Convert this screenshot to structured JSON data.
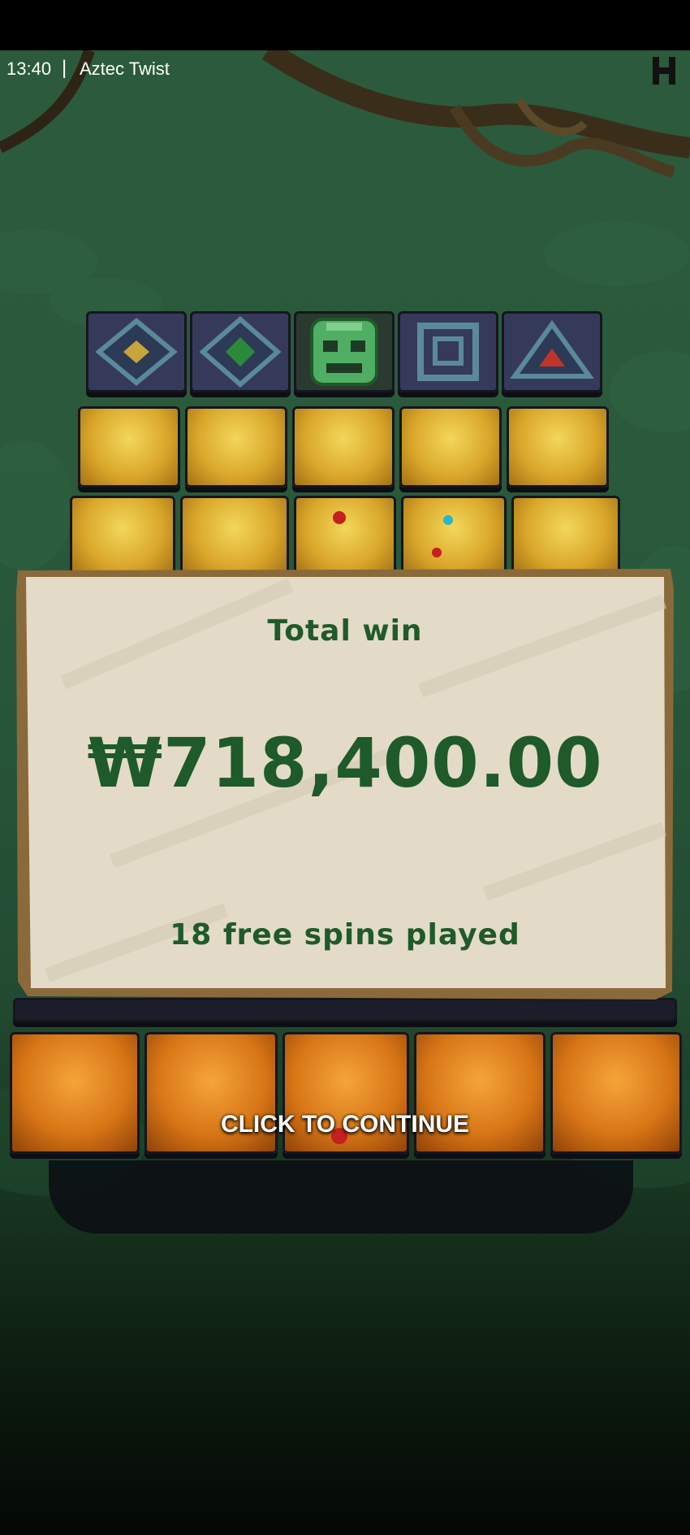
{
  "status_bar": {
    "time": "13:40",
    "separator": "|",
    "app_title": "Aztec Twist"
  },
  "reels": {
    "top_symbols": [
      "gold-diamond-symbol",
      "green-diamond-symbol",
      "mask-symbol",
      "square-spiral-symbol",
      "red-triangle-symbol"
    ]
  },
  "win_panel": {
    "label": "Total win",
    "amount": "₩718,400.00",
    "free_spins_text": "18 free spins played"
  },
  "continue_prompt": "CLICK TO CONTINUE",
  "colors": {
    "panel_text": "#1f5a2a",
    "panel_paper": "#e3dbc7",
    "frame_wood": "#8a6a3a",
    "background_green": "#2a5a3b"
  }
}
